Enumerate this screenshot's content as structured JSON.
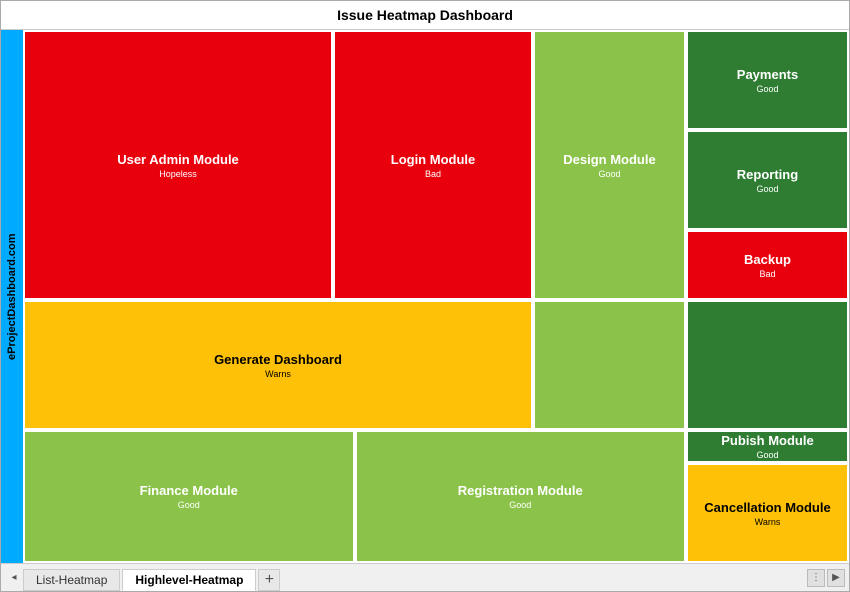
{
  "title": "Issue Heatmap Dashboard",
  "side_label": "eProjectDashboard.com",
  "cells": {
    "user_admin": {
      "title": "User Admin Module",
      "status": "Hopeless",
      "color": "red"
    },
    "login": {
      "title": "Login Module",
      "status": "Bad",
      "color": "red"
    },
    "design": {
      "title": "Design Module",
      "status": "Good",
      "color": "light-green"
    },
    "payments": {
      "title": "Payments",
      "status": "Good",
      "color": "dark-green"
    },
    "reporting": {
      "title": "Reporting",
      "status": "Good",
      "color": "dark-green"
    },
    "backup": {
      "title": "Backup",
      "status": "Bad",
      "color": "red"
    },
    "generate": {
      "title": "Generate Dashboard",
      "status": "Warns",
      "color": "yellow"
    },
    "finance": {
      "title": "Finance Module",
      "status": "Good",
      "color": "light-green"
    },
    "registration": {
      "title": "Registration Module",
      "status": "Good",
      "color": "light-green"
    },
    "publish": {
      "title": "Pubish Module",
      "status": "Good",
      "color": "dark-green"
    },
    "cancellation": {
      "title": "Cancellation Module",
      "status": "Warns",
      "color": "yellow"
    }
  },
  "tabs": [
    {
      "label": "List-Heatmap",
      "active": false
    },
    {
      "label": "Highlevel-Heatmap",
      "active": true
    }
  ],
  "add_tab": "+",
  "scroll_left": "◂",
  "scroll_right": "▸",
  "nav_dots": "⋮",
  "nav_arrow": "▶"
}
